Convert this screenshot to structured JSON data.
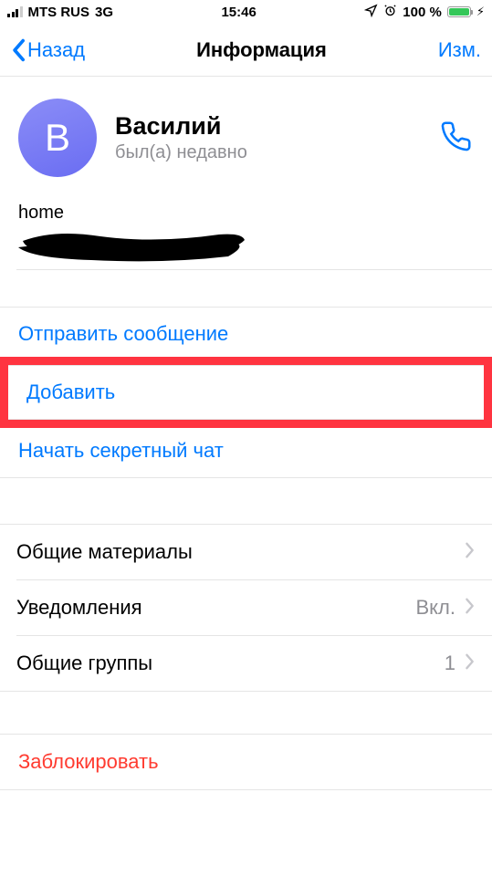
{
  "status": {
    "carrier": "MTS RUS",
    "network": "3G",
    "time": "15:46",
    "battery_text": "100 %"
  },
  "nav": {
    "back": "Назад",
    "title": "Информация",
    "edit": "Изм."
  },
  "contact": {
    "initial": "В",
    "name": "Василий",
    "status": "был(а) недавно"
  },
  "phone": {
    "label": "home"
  },
  "actions": {
    "send_message": "Отправить сообщение",
    "add": "Добавить",
    "secret_chat": "Начать секретный чат"
  },
  "settings": {
    "shared_media": "Общие материалы",
    "notifications": {
      "label": "Уведомления",
      "value": "Вкл."
    },
    "common_groups": {
      "label": "Общие группы",
      "value": "1"
    }
  },
  "block": "Заблокировать"
}
